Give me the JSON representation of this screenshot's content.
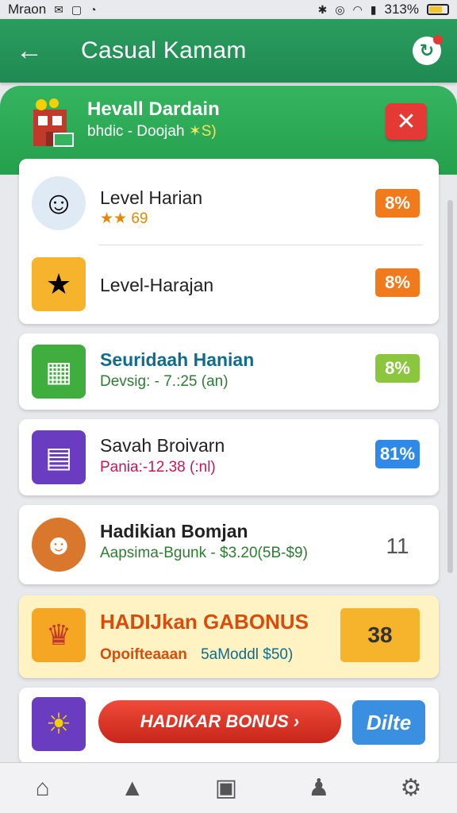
{
  "status_bar": {
    "carrier": "Mraon",
    "battery": "313%"
  },
  "app_bar": {
    "title": "Casual Kamam"
  },
  "banner": {
    "title": "Hevall Dardain",
    "sub_pre": "bhdic - Doojah",
    "sub_accent": "✶S)"
  },
  "rows": [
    {
      "title": "Level Harian",
      "sub": "★★ 69",
      "pct": "8%",
      "pct_color": "#f07a1c"
    },
    {
      "title": "Level-Harajan",
      "pct": "8%",
      "pct_color": "#f07a1c"
    },
    {
      "title": "Seuridaah Hanian",
      "sub": "Devsig: - 7.:25 (an)",
      "pct": "8%",
      "pct_color": "#8cc63f"
    },
    {
      "title": "Savah Broivarn",
      "sub": "Pania:-12.38 (:nl)",
      "pct": "81%",
      "pct_color": "#2e8ae6"
    },
    {
      "title": "Hadikian Bomjan",
      "sub": "Aapsima-Bgunk - $3.20(5B-$9)",
      "num": "11"
    }
  ],
  "promo1": {
    "title": "HADIJkan GABONUS",
    "sub_left": "Opoifteaaan",
    "sub_right": "5aModdl $50)",
    "value": "38"
  },
  "promo2": {
    "button": "HADIKAR BONUS ›",
    "right_button": "Dilte"
  },
  "colors": {
    "green_dark": "#1f8a52",
    "green_banner": "#2fab59",
    "red": "#e53935",
    "orange": "#f07a1c",
    "lime": "#8cc63f",
    "blue": "#2e8ae6"
  }
}
